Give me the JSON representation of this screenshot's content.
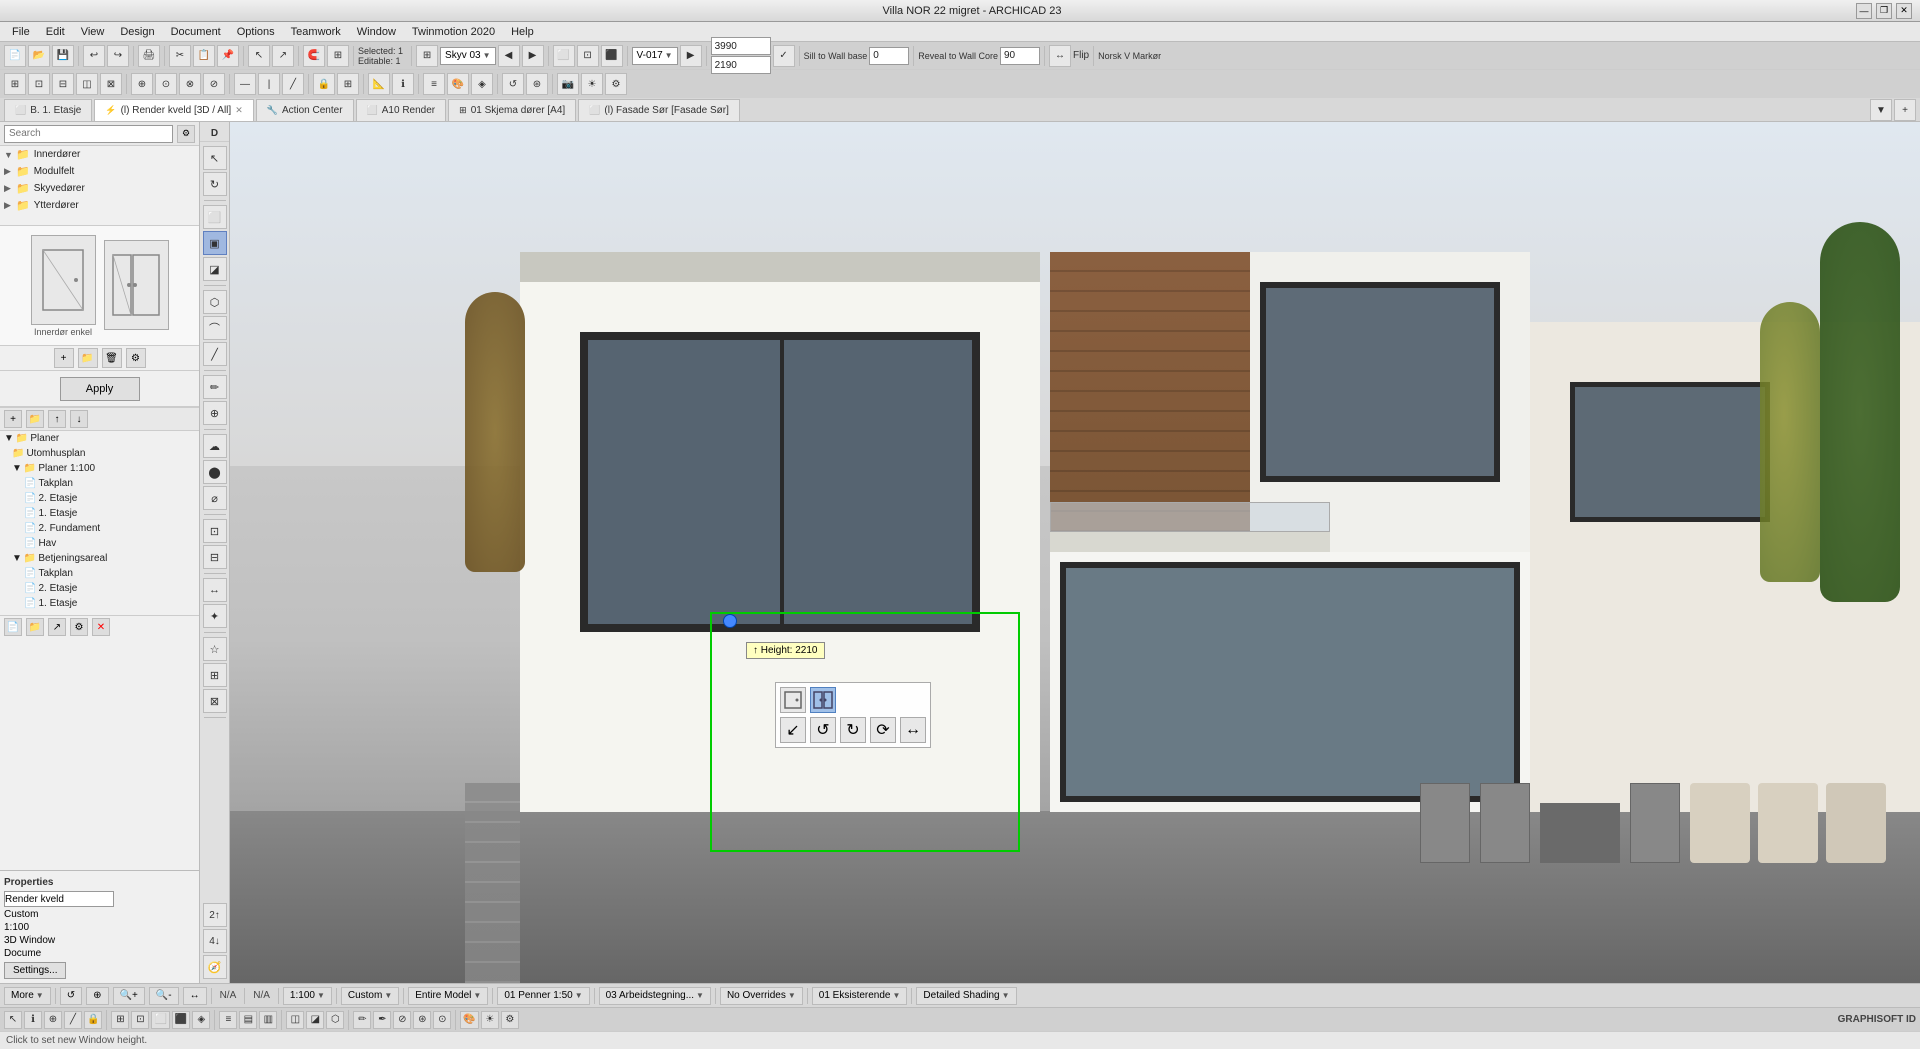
{
  "titleBar": {
    "title": "Villa NOR 22 migret - ARCHICAD 23",
    "minBtn": "—",
    "restoreBtn": "❐",
    "closeBtn": "✕"
  },
  "menuBar": {
    "items": [
      "File",
      "Edit",
      "View",
      "Design",
      "Document",
      "Options",
      "Teamwork",
      "Window",
      "Twinmotion 2020",
      "Help"
    ]
  },
  "toolbar1": {
    "selectedInfo": "Selected: 1",
    "editableInfo": "Editable: 1",
    "viewSelector": "Skyv 03",
    "viewCode": "V-017",
    "dim1": "3990",
    "dim2": "2190",
    "sillLabel": "Sill to Wall base",
    "sillValue": "0",
    "revealLabel": "Reveal to Wall Core",
    "revealValue": "90",
    "flipLabel": "Flip",
    "langSelector": "Norsk V Markør"
  },
  "search": {
    "placeholder": "Search",
    "label": "Search"
  },
  "library": {
    "categories": [
      {
        "label": "Innerdører",
        "icon": "📁",
        "expanded": true
      },
      {
        "label": "Modulfelt",
        "icon": "📁",
        "expanded": false
      },
      {
        "label": "Skyvedører",
        "icon": "📁",
        "expanded": false
      },
      {
        "label": "Ytterdører",
        "icon": "📁",
        "expanded": false
      }
    ]
  },
  "thumbnails": [
    {
      "label": "Innerdør enkel"
    },
    {
      "label": ""
    }
  ],
  "applyBtn": "Apply",
  "treePanel": {
    "sections": [
      {
        "label": "Planer",
        "expanded": true,
        "children": [
          {
            "label": "Utomhusplan",
            "indent": 2
          },
          {
            "label": "Planer 1:100",
            "indent": 2,
            "expanded": true,
            "children": [
              {
                "label": "Takplan",
                "indent": 3
              },
              {
                "label": "2. Etasje",
                "indent": 3
              },
              {
                "label": "1. Etasje",
                "indent": 3
              },
              {
                "label": "2. Fundament",
                "indent": 3
              },
              {
                "label": "Hav",
                "indent": 3
              }
            ]
          },
          {
            "label": "Betjeningsareal",
            "indent": 2,
            "expanded": true,
            "children": [
              {
                "label": "Takplan",
                "indent": 3
              },
              {
                "label": "2. Etasje",
                "indent": 3
              },
              {
                "label": "1. Etasje",
                "indent": 3
              }
            ]
          }
        ]
      }
    ]
  },
  "properties": {
    "title": "Properties",
    "docLabel": "Docume",
    "renderField": "Render kveld",
    "customField": "Custom",
    "scaleField": "1:100",
    "windowType": "3D Window",
    "settingsBtn": "Settings..."
  },
  "tabs": [
    {
      "label": "B. 1. Etasje",
      "icon": "⬜",
      "active": false,
      "closeable": false
    },
    {
      "label": "(l) Render kveld [3D / All]",
      "icon": "⚡",
      "active": true,
      "closeable": true
    },
    {
      "label": "Action Center",
      "icon": "🔧",
      "active": false,
      "closeable": false
    },
    {
      "label": "A10 Render",
      "icon": "⬜",
      "active": false,
      "closeable": false
    },
    {
      "label": "01 Skjema dører [A4]",
      "icon": "⊞",
      "active": false,
      "closeable": false
    },
    {
      "label": "(l) Fasade Sør [Fasade Sør]",
      "icon": "⬜",
      "active": false,
      "closeable": false
    }
  ],
  "viewport": {
    "heightTooltip": "↑ Height: 2210"
  },
  "vertToolbar": {
    "tools": [
      "↖",
      "✜",
      "⬜",
      "⬛",
      "◪",
      "⬡",
      "⌒",
      "╱",
      "✏",
      "⊕",
      "☁",
      "⬤",
      "⌀",
      "⊡",
      "⊟",
      "↔",
      "⊘",
      "⊙",
      "✦",
      "☆",
      "⊞",
      "⊠"
    ]
  },
  "statusBar": {
    "moreBtn": "More",
    "navBtns": [
      "↺",
      "↙",
      "⊕",
      "⊖",
      "↔",
      "N/A",
      "N/A"
    ],
    "scale": "1:100",
    "custom": "Custom",
    "model": "Entire Model",
    "layer1": "01 Penner 1:50",
    "layer2": "03 Arbeidstegning...",
    "overrides": "No Overrides",
    "layer3": "01 Eksisterende",
    "shading": "Detailed Shading"
  },
  "clickStatus": "Click to set new Window height.",
  "graphisoftLogo": "GRAPHISOFT ID"
}
